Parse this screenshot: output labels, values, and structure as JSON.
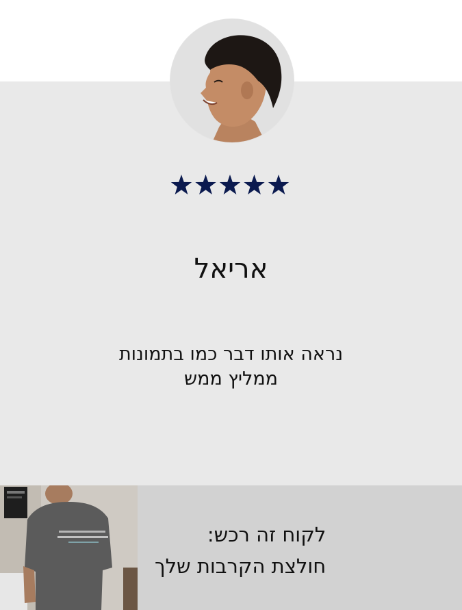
{
  "review": {
    "avatar_icon": "customer-avatar-photo",
    "rating": 5,
    "rating_max": 5,
    "star_color": "#0b1a4f",
    "reviewer_name": "אריאל",
    "text_line1": "נראה אותו דבר כמו בתמונות",
    "text_line2": "ממליץ ממש"
  },
  "footer": {
    "photo_icon": "tshirt-back-photo",
    "line1": "לקוח זה רכש:",
    "line2": "חולצת הקרבות שלך",
    "panel_color": "#d2d2d2"
  }
}
